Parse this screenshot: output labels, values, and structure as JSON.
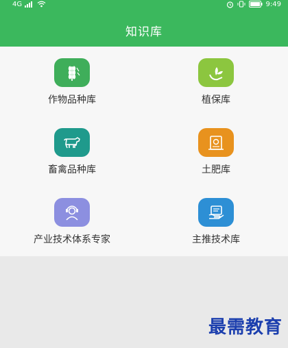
{
  "status_bar": {
    "left_text": "4G",
    "time": "9:49"
  },
  "header": {
    "title": "知识库"
  },
  "items": [
    {
      "label": "作物品种库",
      "icon": "wheat-icon",
      "color": "#3fae5a"
    },
    {
      "label": "植保库",
      "icon": "plant-protection-icon",
      "color": "#8cc63f"
    },
    {
      "label": "畜禽品种库",
      "icon": "cow-icon",
      "color": "#1f9a8c"
    },
    {
      "label": "土肥库",
      "icon": "fertilizer-icon",
      "color": "#e8921e"
    },
    {
      "label": "产业技术体系专家",
      "icon": "expert-icon",
      "color": "#8c8fe0"
    },
    {
      "label": "主推技术库",
      "icon": "technology-icon",
      "color": "#2d8fd5"
    }
  ],
  "watermark": "最需教育"
}
